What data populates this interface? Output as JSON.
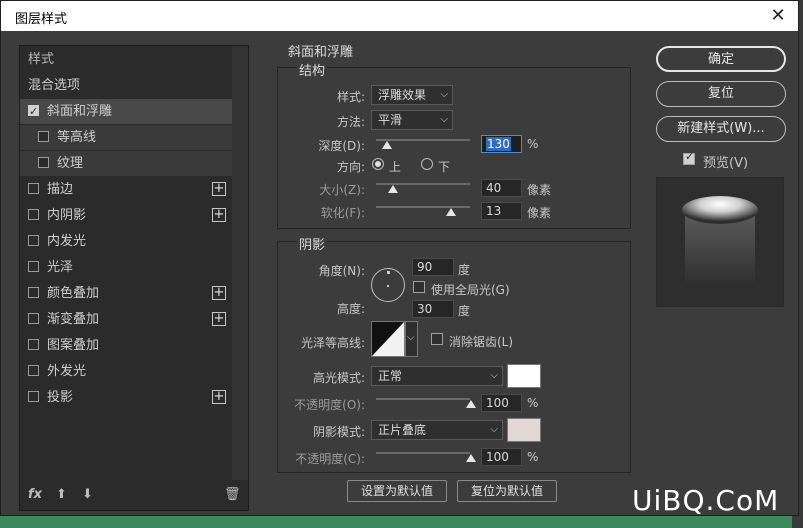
{
  "window": {
    "title": "图层样式",
    "close_icon": "✕"
  },
  "style_list": {
    "items": [
      {
        "label": "样式",
        "checkbox": false,
        "checked": false,
        "plus": false,
        "indent": 0,
        "state": "header"
      },
      {
        "label": "混合选项",
        "checkbox": false,
        "checked": false,
        "plus": false,
        "indent": 0,
        "state": "normal"
      },
      {
        "label": "斜面和浮雕",
        "checkbox": true,
        "checked": true,
        "plus": false,
        "indent": 0,
        "state": "selected"
      },
      {
        "label": "等高线",
        "checkbox": true,
        "checked": false,
        "plus": false,
        "indent": 1,
        "state": "sub"
      },
      {
        "label": "纹理",
        "checkbox": true,
        "checked": false,
        "plus": false,
        "indent": 1,
        "state": "sub"
      },
      {
        "label": "描边",
        "checkbox": true,
        "checked": false,
        "plus": true,
        "indent": 0,
        "state": "normal"
      },
      {
        "label": "内阴影",
        "checkbox": true,
        "checked": false,
        "plus": true,
        "indent": 0,
        "state": "normal"
      },
      {
        "label": "内发光",
        "checkbox": true,
        "checked": false,
        "plus": false,
        "indent": 0,
        "state": "normal"
      },
      {
        "label": "光泽",
        "checkbox": true,
        "checked": false,
        "plus": false,
        "indent": 0,
        "state": "normal"
      },
      {
        "label": "颜色叠加",
        "checkbox": true,
        "checked": false,
        "plus": true,
        "indent": 0,
        "state": "normal"
      },
      {
        "label": "渐变叠加",
        "checkbox": true,
        "checked": false,
        "plus": true,
        "indent": 0,
        "state": "normal"
      },
      {
        "label": "图案叠加",
        "checkbox": true,
        "checked": false,
        "plus": false,
        "indent": 0,
        "state": "normal"
      },
      {
        "label": "外发光",
        "checkbox": true,
        "checked": false,
        "plus": false,
        "indent": 0,
        "state": "normal"
      },
      {
        "label": "投影",
        "checkbox": true,
        "checked": false,
        "plus": true,
        "indent": 0,
        "state": "normal"
      }
    ],
    "bottom": {
      "fx": "fx",
      "up": "⬆",
      "down": "⬇",
      "trash": "🗑"
    }
  },
  "bevel": {
    "section_title": "斜面和浮雕",
    "structure_title": "结构",
    "style_label": "样式:",
    "style_value": "浮雕效果",
    "technique_label": "方法:",
    "technique_value": "平滑",
    "depth_label": "深度(D):",
    "depth_value": "130",
    "depth_unit": "%",
    "depth_level": 0.12,
    "direction_label": "方向:",
    "dir_up": "上",
    "dir_down": "下",
    "size_label": "大小(Z):",
    "size_value": "40",
    "size_unit": "像素",
    "size_level": 0.18,
    "soften_label": "软化(F):",
    "soften_value": "13",
    "soften_unit": "像素",
    "soften_level": 0.8
  },
  "shading": {
    "title": "阴影",
    "angle_label": "角度(N):",
    "angle_value": "90",
    "angle_unit": "度",
    "global_light_label": "使用全局光(G)",
    "altitude_label": "高度:",
    "altitude_value": "30",
    "altitude_unit": "度",
    "gloss_label": "光泽等高线:",
    "antialias_label": "消除锯齿(L)",
    "highlight_label": "高光模式:",
    "highlight_value": "正常",
    "highlight_color": "#ffffff",
    "opacity1_label": "不透明度(O):",
    "opacity1_value": "100",
    "opacity1_unit": "%",
    "shadow_label": "阴影模式:",
    "shadow_value": "正片叠底",
    "shadow_color": "#e2d9d6",
    "opacity2_label": "不透明度(C):",
    "opacity2_value": "100",
    "opacity2_unit": "%"
  },
  "buttons": {
    "set_default": "设置为默认值",
    "reset_default": "复位为默认值",
    "ok": "确定",
    "reset": "复位",
    "new_style": "新建样式(W)...",
    "preview": "预览(V)"
  },
  "watermark": "UiBQ.CoM"
}
